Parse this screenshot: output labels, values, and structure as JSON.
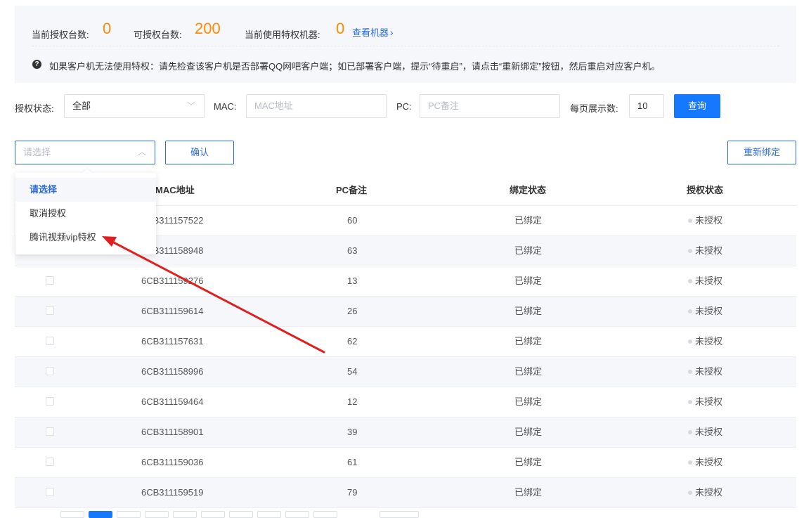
{
  "summary": {
    "authorized_label": "当前授权台数:",
    "authorized_value": "0",
    "available_label": "可授权台数:",
    "available_value": "200",
    "in_use_label": "当前使用特权机器:",
    "in_use_value": "0",
    "view_link": "查看机器",
    "notice": "如果客户机无法使用特权：请先检查该客户机是否部署QQ网吧客户端；如已部署客户端，提示“待重启”，请点击“重新绑定”按钮，然后重启对应客户机。"
  },
  "filters": {
    "status_label": "授权状态:",
    "status_value": "全部",
    "mac_label": "MAC:",
    "mac_placeholder": "MAC地址",
    "pc_label": "PC:",
    "pc_placeholder": "PC备注",
    "page_size_label": "每页展示数:",
    "page_size_value": "10",
    "query_button": "查询"
  },
  "actions": {
    "select_placeholder": "请选择",
    "confirm_button": "确认",
    "rebind_button": "重新绑定"
  },
  "dropdown": {
    "options": [
      "请选择",
      "取消授权",
      "腾讯视频vip特权"
    ],
    "selected_index": 0
  },
  "table": {
    "headers": {
      "mac": "MAC地址",
      "pc": "PC备注",
      "bind": "绑定状态",
      "auth": "授权状态"
    },
    "rows": [
      {
        "mac": "6CB311157522",
        "pc": "60",
        "bind": "已绑定",
        "auth": "未授权"
      },
      {
        "mac": "6CB311158948",
        "pc": "63",
        "bind": "已绑定",
        "auth": "未授权"
      },
      {
        "mac": "6CB311159276",
        "pc": "13",
        "bind": "已绑定",
        "auth": "未授权"
      },
      {
        "mac": "6CB311159614",
        "pc": "26",
        "bind": "已绑定",
        "auth": "未授权"
      },
      {
        "mac": "6CB311157631",
        "pc": "62",
        "bind": "已绑定",
        "auth": "未授权"
      },
      {
        "mac": "6CB311158996",
        "pc": "54",
        "bind": "已绑定",
        "auth": "未授权"
      },
      {
        "mac": "6CB311159464",
        "pc": "12",
        "bind": "已绑定",
        "auth": "未授权"
      },
      {
        "mac": "6CB311158901",
        "pc": "39",
        "bind": "已绑定",
        "auth": "未授权"
      },
      {
        "mac": "6CB311159036",
        "pc": "61",
        "bind": "已绑定",
        "auth": "未授权"
      },
      {
        "mac": "6CB311159519",
        "pc": "79",
        "bind": "已绑定",
        "auth": "未授权"
      }
    ]
  },
  "colors": {
    "accent": "#2d6cdf",
    "primary_button": "#1677ff",
    "highlight_number": "#ff8a00",
    "annotation_arrow": "#e02020"
  }
}
